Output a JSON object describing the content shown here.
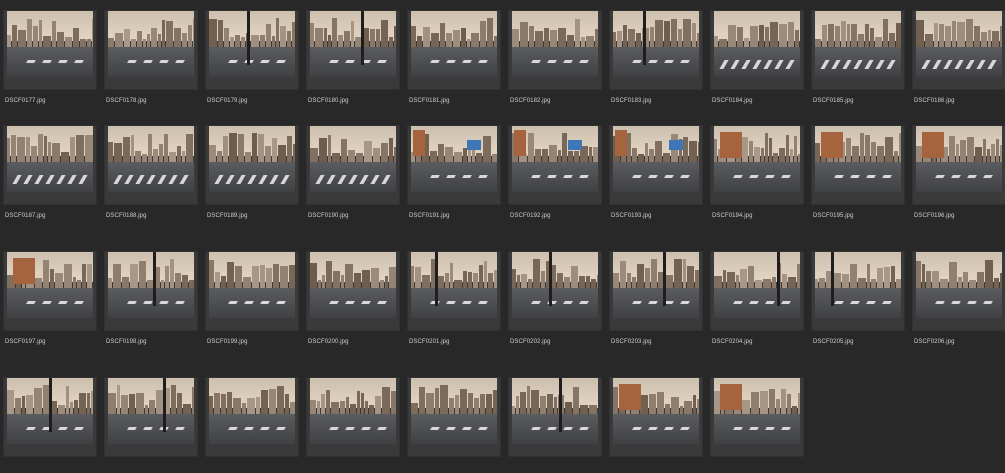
{
  "browser": {
    "items": [
      {
        "filename": "DSCF0177.jpg",
        "scene": "skyline"
      },
      {
        "filename": "DSCF0178.jpg",
        "scene": "skyline"
      },
      {
        "filename": "DSCF0179.jpg",
        "scene": "skyline-pole"
      },
      {
        "filename": "DSCF0180.jpg",
        "scene": "skyline-pole"
      },
      {
        "filename": "DSCF0181.jpg",
        "scene": "skyline"
      },
      {
        "filename": "DSCF0182.jpg",
        "scene": "skyline"
      },
      {
        "filename": "DSCF0183.jpg",
        "scene": "skyline-pole"
      },
      {
        "filename": "DSCF0184.jpg",
        "scene": "crosswalk"
      },
      {
        "filename": "DSCF0185.jpg",
        "scene": "crosswalk"
      },
      {
        "filename": "DSCF0186.jpg",
        "scene": "crosswalk"
      },
      {
        "filename": "DSCF0187.jpg",
        "scene": "crosswalk"
      },
      {
        "filename": "DSCF0188.jpg",
        "scene": "crosswalk"
      },
      {
        "filename": "DSCF0189.jpg",
        "scene": "crosswalk"
      },
      {
        "filename": "DSCF0190.jpg",
        "scene": "crosswalk"
      },
      {
        "filename": "DSCF0191.jpg",
        "scene": "billboard"
      },
      {
        "filename": "DSCF0192.jpg",
        "scene": "billboard"
      },
      {
        "filename": "DSCF0193.jpg",
        "scene": "billboard"
      },
      {
        "filename": "DSCF0194.jpg",
        "scene": "orange-building"
      },
      {
        "filename": "DSCF0195.jpg",
        "scene": "orange-building"
      },
      {
        "filename": "DSCF0196.jpg",
        "scene": "orange-building"
      },
      {
        "filename": "DSCF0197.jpg",
        "scene": "orange-building"
      },
      {
        "filename": "DSCF0198.jpg",
        "scene": "skyline-pole"
      },
      {
        "filename": "DSCF0199.jpg",
        "scene": "skyline"
      },
      {
        "filename": "DSCF0200.jpg",
        "scene": "skyline"
      },
      {
        "filename": "DSCF0201.jpg",
        "scene": "skyline-pole"
      },
      {
        "filename": "DSCF0202.jpg",
        "scene": "skyline-pole"
      },
      {
        "filename": "DSCF0203.jpg",
        "scene": "skyline-pole"
      },
      {
        "filename": "DSCF0204.jpg",
        "scene": "skyline-pole"
      },
      {
        "filename": "DSCF0205.jpg",
        "scene": "skyline-pole"
      },
      {
        "filename": "DSCF0206.jpg",
        "scene": "skyline"
      },
      {
        "filename": "",
        "scene": "skyline-pole"
      },
      {
        "filename": "",
        "scene": "skyline-pole"
      },
      {
        "filename": "",
        "scene": "skyline"
      },
      {
        "filename": "",
        "scene": "skyline"
      },
      {
        "filename": "",
        "scene": "skyline"
      },
      {
        "filename": "",
        "scene": "skyline-pole"
      },
      {
        "filename": "",
        "scene": "orange-building"
      },
      {
        "filename": "",
        "scene": "orange-building"
      }
    ]
  },
  "colors": {
    "background": "#282828",
    "frame": "#3a3a3a",
    "label": "#cfcfcf"
  }
}
